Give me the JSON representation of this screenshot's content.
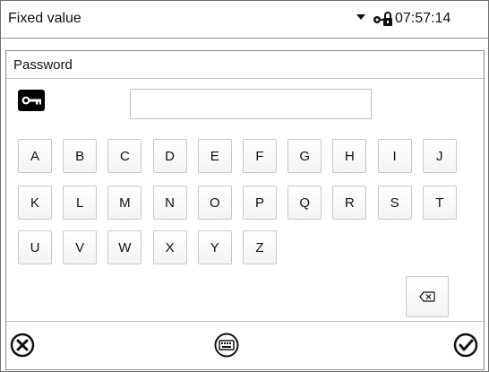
{
  "status_bar": {
    "title": "Fixed value",
    "time": "07:57:14",
    "dropdown_icon": "chevron-down-icon",
    "lock_icon": "lock-icon"
  },
  "dialog": {
    "title": "Password",
    "key_icon": "key-icon",
    "password_input": {
      "value": "",
      "placeholder": ""
    },
    "keyboard_rows": [
      [
        "A",
        "B",
        "C",
        "D",
        "E",
        "F",
        "G",
        "H",
        "I",
        "J"
      ],
      [
        "K",
        "L",
        "M",
        "N",
        "O",
        "P",
        "Q",
        "R",
        "S",
        "T"
      ],
      [
        "U",
        "V",
        "W",
        "X",
        "Y",
        "Z"
      ]
    ],
    "backspace_icon": "backspace-icon"
  },
  "footer": {
    "cancel_icon": "close-circle-icon",
    "keyboard_icon": "keyboard-icon",
    "confirm_icon": "check-circle-icon"
  }
}
